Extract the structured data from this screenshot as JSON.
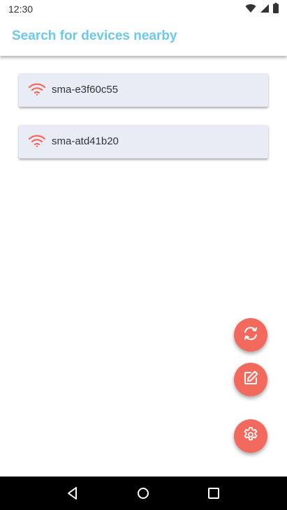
{
  "status_bar": {
    "time": "12:30"
  },
  "app_bar": {
    "title": "Search for devices nearby"
  },
  "devices": [
    {
      "name": "sma-e3f60c55"
    },
    {
      "name": "sma-atd41b20"
    }
  ],
  "fabs": [
    {
      "icon": "refresh-icon"
    },
    {
      "icon": "edit-icon"
    },
    {
      "icon": "gear-icon"
    }
  ],
  "nav_bar": {
    "icons": [
      "back-icon",
      "home-icon",
      "recents-icon"
    ]
  },
  "colors": {
    "title": "#6cc8ec",
    "accent": "#f26a5e",
    "card": "#e9ecf5",
    "nav": "#000000"
  }
}
